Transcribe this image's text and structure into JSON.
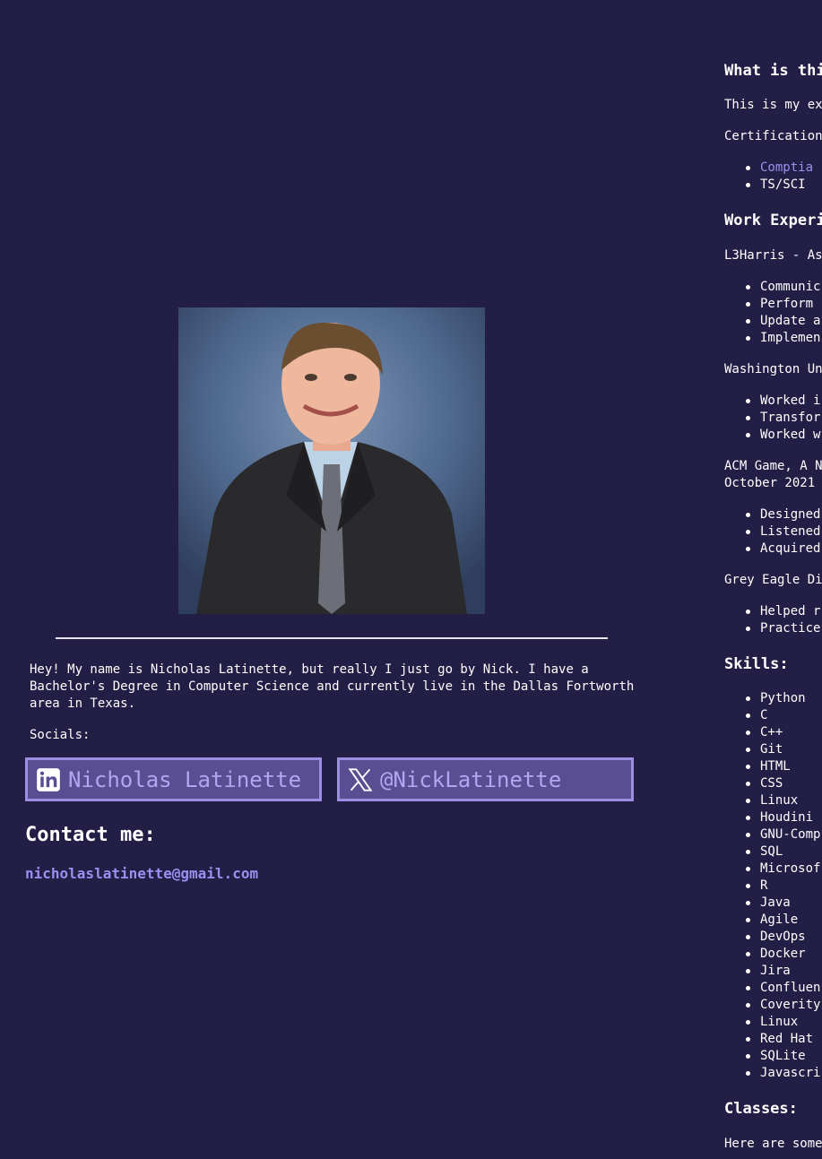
{
  "profile": {
    "photo_alt": "Portrait photo",
    "bio": "Hey! My name is Nicholas Latinette, but really I just go by Nick. I have a Bachelor's Degree in Computer Science and currently live in the Dallas Fortworth area in Texas.",
    "socials_label": "Socials:",
    "linkedin_label": "Nicholas Latinette",
    "linkedin_icon": "linkedin-icon",
    "twitter_label": "@NickLatinette",
    "twitter_icon": "x-icon",
    "contact_heading": "Contact me:",
    "contact_email": "nicholaslatinette@gmail.com"
  },
  "right": {
    "what_heading": "What is thi",
    "intro": "This is my ex",
    "certifications_label": "Certification",
    "certifications": [
      "Comptia",
      "TS/SCI"
    ],
    "work_heading": "Work Experi",
    "job1_title": "L3Harris - As",
    "job1_items": [
      "Communic",
      "Perform",
      "Update a",
      "Implemen"
    ],
    "job2_title": "Washington Un",
    "job2_items": [
      "Worked i",
      "Transfor",
      "Worked w"
    ],
    "job3_title_line1": "ACM Game, A N",
    "job3_title_line2": "October 2021",
    "job3_items": [
      "Designed",
      "Listened",
      "Acquired"
    ],
    "job4_title": "Grey Eagle Di",
    "job4_items": [
      "Helped r",
      "Practice"
    ],
    "skills_heading": "Skills:",
    "skills": [
      "Python",
      "C",
      "C++",
      "Git",
      "HTML",
      "CSS",
      "Linux",
      "Houdini",
      "GNU-Comp",
      "SQL",
      "Microsof",
      "R",
      "Java",
      "Agile",
      "DevOps",
      "Docker",
      "Jira",
      "Confluen",
      "Coverity",
      "Linux",
      "Red Hat",
      "SQLite",
      "Javascri"
    ],
    "classes_heading": "Classes:",
    "classes_intro": "Here are some"
  },
  "colors": {
    "background": "#221e45",
    "accent": "#9d8ff0",
    "button_fill": "#5a4e92"
  }
}
